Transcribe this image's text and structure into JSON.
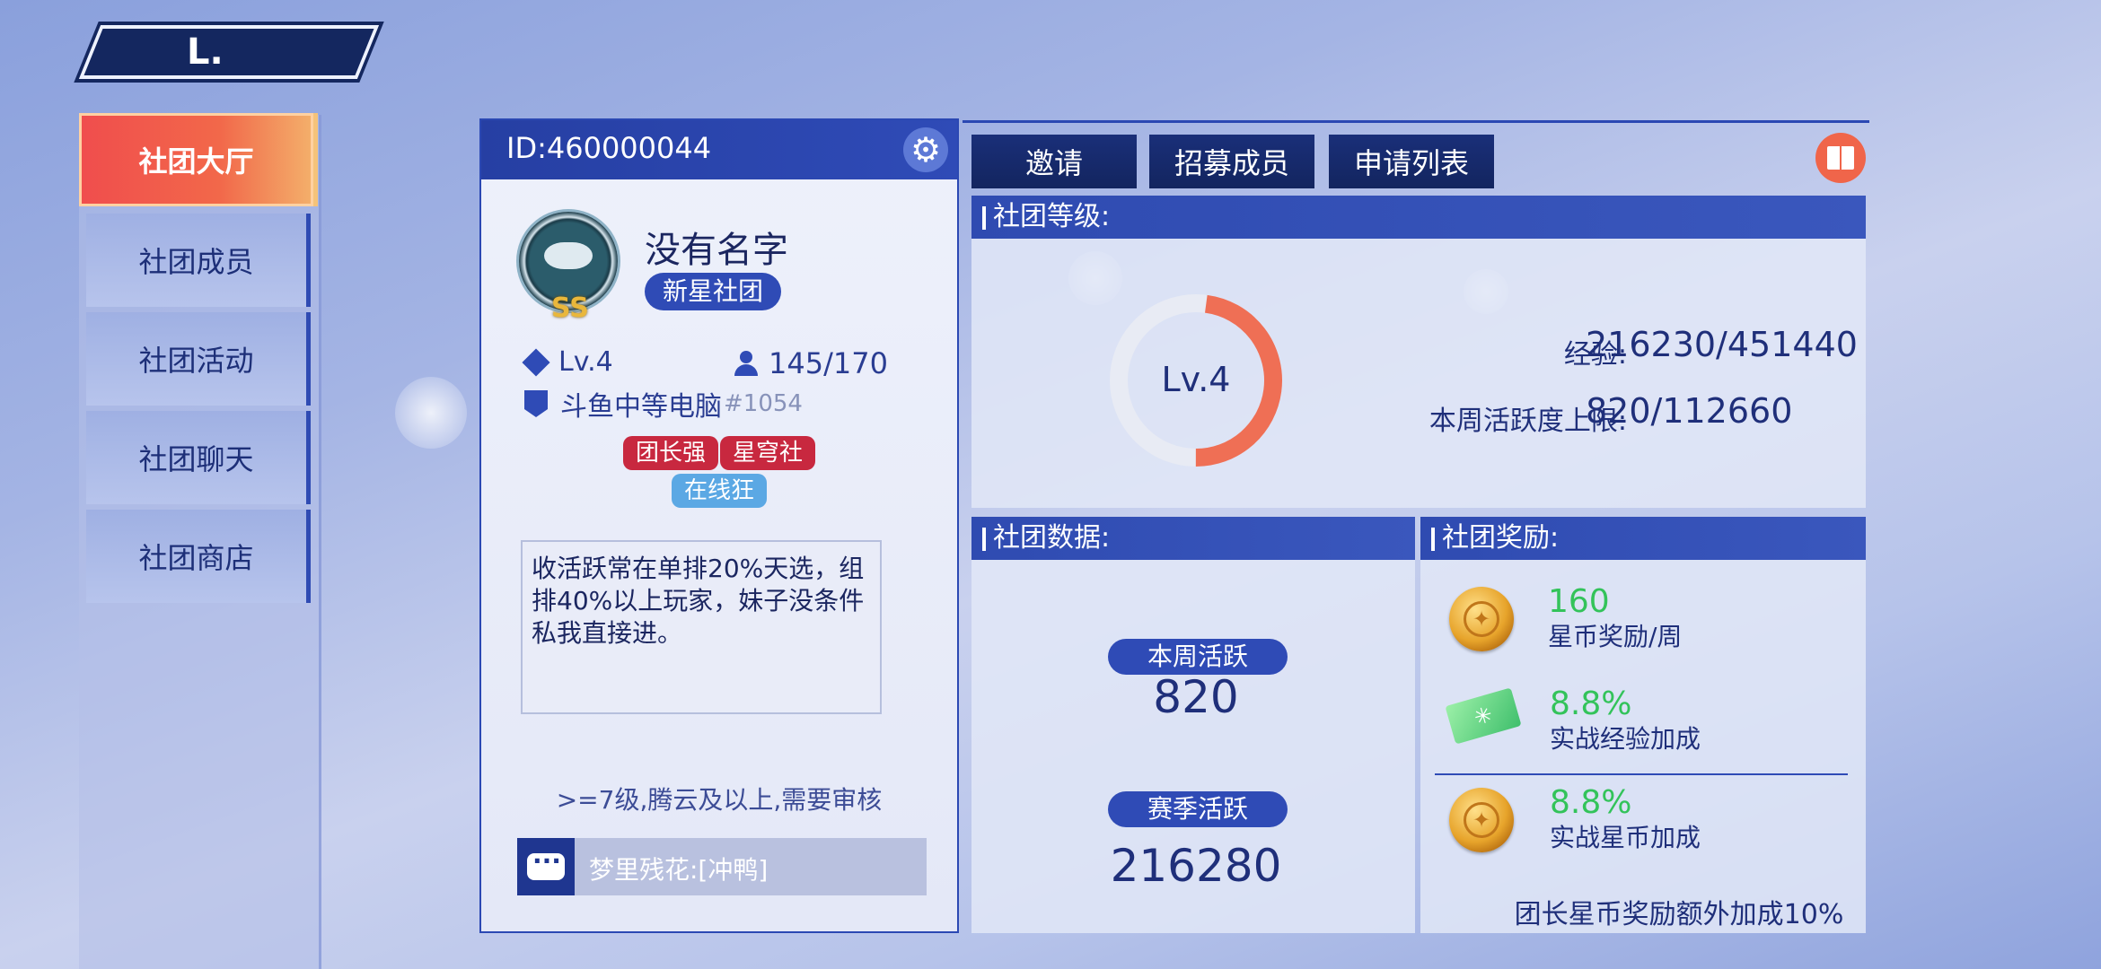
{
  "back_button": {
    "label": "L."
  },
  "sidebar": {
    "items": [
      {
        "label": "社团大厅",
        "active": true
      },
      {
        "label": "社团成员",
        "active": false
      },
      {
        "label": "社团活动",
        "active": false
      },
      {
        "label": "社团聊天",
        "active": false
      },
      {
        "label": "社团商店",
        "active": false
      }
    ]
  },
  "profile": {
    "id": "ID:460000044",
    "emblem_rank": "SS",
    "name": "没有名字",
    "type_badge": "新星社团",
    "level": "Lv.4",
    "members": "145/170",
    "server": "斗鱼中等电脑",
    "server_id": "#1054",
    "tags": [
      "团长强",
      "星穹社"
    ],
    "tags_row2": [
      "在线狂"
    ],
    "description": "收活跃常在单排20%天选，组排40%以上玩家，妹子没条件私我直接进。",
    "requirement": ">=7级,腾云及以上,需要审核",
    "chat_preview": "梦里残花:[冲鸭]"
  },
  "top_actions": {
    "invite": "邀请",
    "recruit": "招募成员",
    "applications": "申请列表"
  },
  "level_section": {
    "title": "社团等级:",
    "level_label": "Lv.4",
    "progress": 0.479,
    "exp_label": "经验:",
    "exp_value": "216230/451440",
    "weekly_cap_label": "本周活跃度上限:",
    "weekly_cap_value": "820/112660"
  },
  "data_section": {
    "title": "社团数据:",
    "weekly_label": "本周活跃",
    "weekly_value": "820",
    "season_label": "赛季活跃",
    "season_value": "216280"
  },
  "reward_section": {
    "title": "社团奖励:",
    "items": [
      {
        "icon": "star-coin-icon",
        "value": "160",
        "label": "星币奖励/周"
      },
      {
        "icon": "exp-ticket-icon",
        "value": "8.8%",
        "label": "实战经验加成"
      },
      {
        "icon": "star-coin-icon",
        "value": "8.8%",
        "label": "实战星币加成"
      }
    ],
    "footer": "团长星币奖励额外加成10%"
  },
  "colors": {
    "accent_blue": "#2f4bb6",
    "active_tab_red": "#f04d4d",
    "reward_green": "#33c35a",
    "ring_orange": "#ef6f55"
  }
}
